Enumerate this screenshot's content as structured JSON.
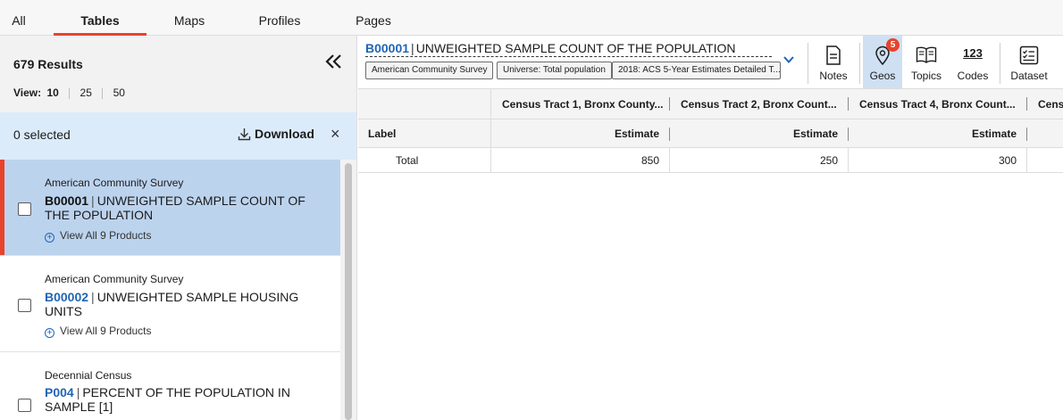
{
  "tabs": [
    {
      "label": "All",
      "active": false
    },
    {
      "label": "Tables",
      "active": true
    },
    {
      "label": "Maps",
      "active": false
    },
    {
      "label": "Profiles",
      "active": false
    },
    {
      "label": "Pages",
      "active": false
    }
  ],
  "accent_color": "#e8432b",
  "link_color": "#1f65b5",
  "results": {
    "count_label": "679 Results",
    "collapse_icon": "double-chevron-left-icon",
    "view_label": "View:",
    "view_options": [
      "10",
      "25",
      "50"
    ],
    "view_selected": "10"
  },
  "selection": {
    "count_label": "0 selected",
    "download_label": "Download",
    "close_symbol": "×"
  },
  "items": [
    {
      "survey": "American Community Survey",
      "code": "B00001",
      "title": "UNWEIGHTED SAMPLE COUNT OF THE POPULATION",
      "products": "View All 9 Products",
      "selected": true,
      "checked": false
    },
    {
      "survey": "American Community Survey",
      "code": "B00002",
      "title": "UNWEIGHTED SAMPLE HOUSING UNITS",
      "products": "View All 9 Products",
      "selected": false,
      "checked": false
    },
    {
      "survey": "Decennial Census",
      "code": "P004",
      "title": "PERCENT OF THE POPULATION IN SAMPLE [1]",
      "products": "",
      "selected": false,
      "checked": false
    }
  ],
  "table": {
    "code": "B00001",
    "pipe": "|",
    "title": "UNWEIGHTED SAMPLE COUNT OF THE POPULATION",
    "chips": [
      "American Community Survey",
      "Universe: Total population",
      "2018: ACS 5-Year Estimates Detailed T..."
    ]
  },
  "tools": [
    {
      "label": "Notes",
      "icon": "notes-icon"
    },
    {
      "label": "Geos",
      "icon": "map-pin-icon",
      "badge": "5",
      "active": true
    },
    {
      "label": "Topics",
      "icon": "book-icon"
    },
    {
      "label": "Codes",
      "icon": "codes-icon",
      "glyph": "123"
    },
    {
      "label": "Dataset",
      "icon": "checklist-icon"
    }
  ],
  "grid": {
    "geo_headers": [
      "Census Tract 1, Bronx County...",
      "Census Tract 2, Bronx Count...",
      "Census Tract 4, Bronx Count...",
      "Cens"
    ],
    "label_header": "Label",
    "estimate_header": "Estimate",
    "rows": [
      {
        "label": "Total",
        "values": [
          "850",
          "250",
          "300"
        ]
      }
    ]
  }
}
